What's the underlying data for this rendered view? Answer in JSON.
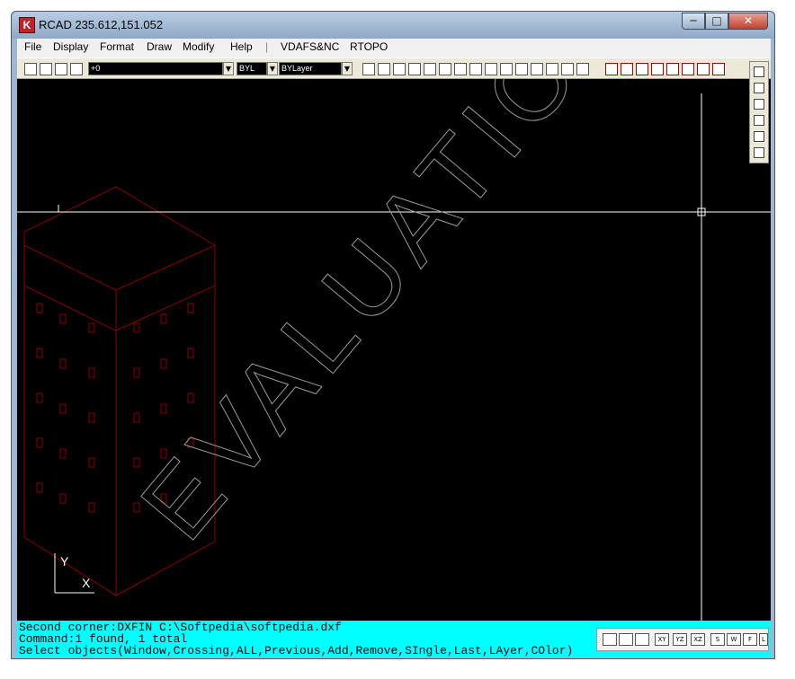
{
  "window": {
    "title": "RCAD  235.612,151.052",
    "app_icon": "rcad-logo-icon",
    "controls": {
      "minimize": "─",
      "maximize": "□",
      "close": "✕"
    }
  },
  "menu": {
    "items": [
      "File",
      "Display",
      "Format",
      "Draw",
      "Modify",
      "Help",
      "|",
      "VDAFS&NC",
      "RTOPO"
    ]
  },
  "toolbar": {
    "layer_value": "+0",
    "color_value": "BYL",
    "linetype_value": "BYLayer",
    "dropdown_arrow": "▼"
  },
  "canvas": {
    "background": "#000000",
    "watermark": "EVALUATION.",
    "ucs_x": "X",
    "ucs_y": "Y",
    "building_color": "#8b0000"
  },
  "command": {
    "lines": [
      "Second corner:DXFIN C:\\Softpedia\\softpedia.dxf",
      "Command:1 found, 1 total",
      "Select objects(Window,Crossing,ALL,Previous,Add,Remove,SIngle,Last,LAyer,COlor)"
    ],
    "background": "#00ffff"
  },
  "status": {
    "buttons": [
      "XY",
      "YZ",
      "XZ",
      "S",
      "W",
      "F",
      "L"
    ]
  }
}
